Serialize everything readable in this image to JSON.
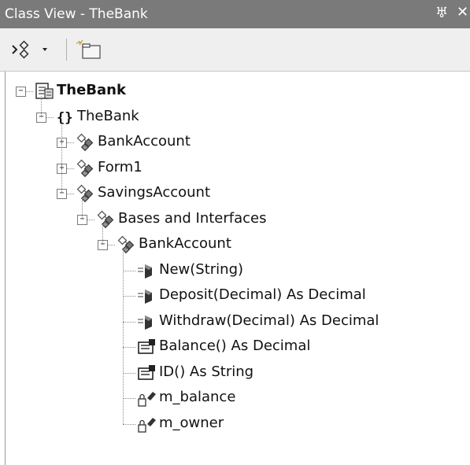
{
  "window": {
    "title": "Class View - TheBank",
    "pin_glyph": "♅",
    "close_glyph": "✕"
  },
  "toolbar": {
    "buttons": [
      {
        "icon": "sort-by-icon",
        "has_dropdown": true
      },
      {
        "icon": "new-folder-icon",
        "has_dropdown": false
      }
    ]
  },
  "tree": {
    "nodes": [
      {
        "label": "TheBank",
        "icon": "project-icon",
        "expander": "minus",
        "bold": true
      },
      {
        "label": "TheBank",
        "icon": "namespace-icon",
        "icon_text": "{}",
        "expander": "minus",
        "bold": false
      },
      {
        "label": "BankAccount",
        "icon": "class-icon",
        "expander": "plus",
        "bold": false
      },
      {
        "label": "Form1",
        "icon": "class-icon",
        "expander": "plus",
        "bold": false
      },
      {
        "label": "SavingsAccount",
        "icon": "class-icon",
        "expander": "minus",
        "bold": false
      },
      {
        "label": "Bases and Interfaces",
        "icon": "class-icon",
        "expander": "minus",
        "bold": false
      },
      {
        "label": "BankAccount",
        "icon": "class-icon",
        "expander": "minus",
        "bold": false
      },
      {
        "label": "New(String)",
        "icon": "method-icon",
        "expander": "none",
        "bold": false
      },
      {
        "label": "Deposit(Decimal) As Decimal",
        "icon": "method-icon",
        "expander": "none",
        "bold": false
      },
      {
        "label": "Withdraw(Decimal) As Decimal",
        "icon": "method-icon",
        "expander": "none",
        "bold": false
      },
      {
        "label": "Balance() As Decimal",
        "icon": "property-icon",
        "expander": "none",
        "bold": false
      },
      {
        "label": "ID() As String",
        "icon": "property-icon",
        "expander": "none",
        "bold": false
      },
      {
        "label": "m_balance",
        "icon": "private-field-icon",
        "expander": "none",
        "bold": false
      },
      {
        "label": "m_owner",
        "icon": "private-field-icon",
        "expander": "none",
        "bold": false
      }
    ]
  }
}
